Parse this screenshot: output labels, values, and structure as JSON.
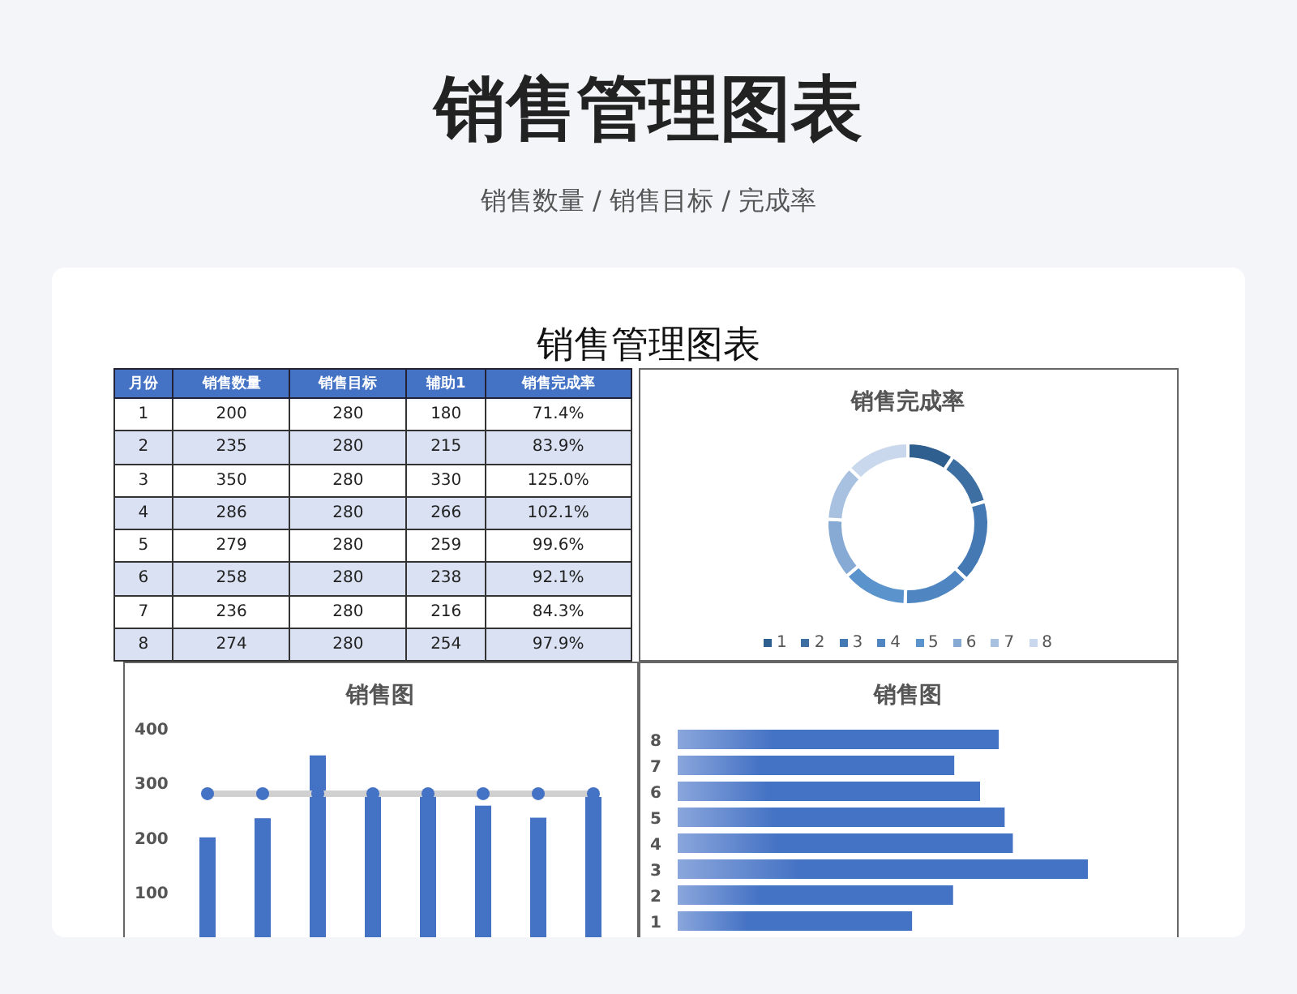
{
  "header": {
    "title": "销售管理图表",
    "subtitle": "销售数量 / 销售目标 / 完成率"
  },
  "sheet": {
    "title": "销售管理图表",
    "table": {
      "columns": [
        "月份",
        "销售数量",
        "销售目标",
        "辅助1",
        "销售完成率"
      ],
      "rows": [
        [
          "1",
          "200",
          "280",
          "180",
          "71.4%"
        ],
        [
          "2",
          "235",
          "280",
          "215",
          "83.9%"
        ],
        [
          "3",
          "350",
          "280",
          "330",
          "125.0%"
        ],
        [
          "4",
          "286",
          "280",
          "266",
          "102.1%"
        ],
        [
          "5",
          "279",
          "280",
          "259",
          "99.6%"
        ],
        [
          "6",
          "258",
          "280",
          "238",
          "92.1%"
        ],
        [
          "7",
          "236",
          "280",
          "216",
          "84.3%"
        ],
        [
          "8",
          "274",
          "280",
          "254",
          "97.9%"
        ]
      ]
    },
    "donut_chart": {
      "title": "销售完成率",
      "chart_data": {
        "type": "donut",
        "categories": [
          "1",
          "2",
          "3",
          "4",
          "5",
          "6",
          "7",
          "8"
        ],
        "values": [
          9.44,
          11.09,
          16.53,
          13.5,
          13.17,
          12.18,
          11.15,
          12.94
        ]
      }
    },
    "column_chart": {
      "title": "销售图",
      "y_axis_labels": [
        "400",
        "300",
        "200",
        "100"
      ]
    },
    "bar_chart": {
      "title": "销售图",
      "y_axis_labels": [
        "8",
        "7",
        "6",
        "5",
        "4",
        "3",
        "2",
        "1"
      ]
    }
  }
}
